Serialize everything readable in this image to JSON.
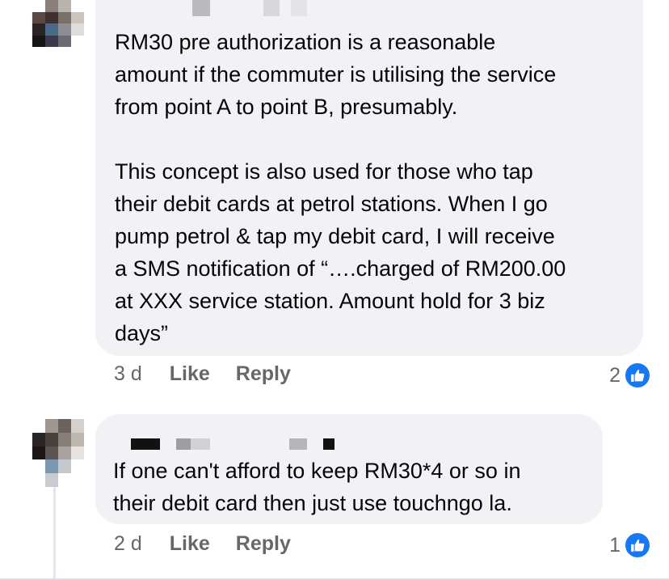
{
  "comments": [
    {
      "text": "RM30 pre authorization is a reasonable\namount if the commuter is utilising the service\nfrom point A to point B, presumably.\n\nThis concept is also used for those who tap\ntheir debit cards at petrol stations. When I go\npump petrol & tap my debit card, I will receive\na SMS notification of “….charged of RM200.00\nat XXX service station. Amount hold for 3 biz\ndays”",
      "time": "3 d",
      "like_label": "Like",
      "reply_label": "Reply",
      "reaction_count": "2"
    },
    {
      "text": "If one can't afford to keep RM30*4 or so in\ntheir debit card then just use touchngo la.",
      "time": "2 d",
      "like_label": "Like",
      "reply_label": "Reply",
      "reaction_count": "1"
    }
  ],
  "icons": {
    "reaction": "thumbs-up-icon"
  },
  "colors": {
    "bubble": "#f0f2f5",
    "meta_text": "#65676b",
    "like_blue": "#1877f2"
  }
}
